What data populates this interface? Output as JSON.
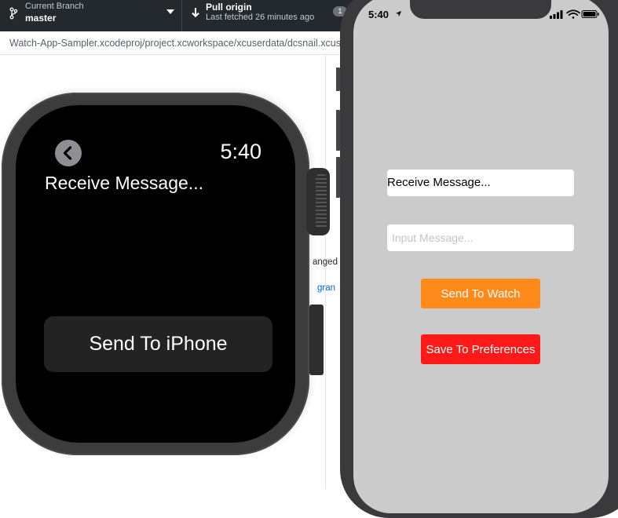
{
  "github_desktop": {
    "current_branch_caption": "Current Branch",
    "current_branch_name": "master",
    "pull_title": "Pull origin",
    "pull_subtitle": "Last fetched 26 minutes ago",
    "badge_count": "1",
    "file_path": "Watch-App-Sampler.xcodeproj/project.xcworkspace/xcuserdata/dcsnail.xcuserdatad/UserInterfaceState.xcuserstate",
    "fragment_changed": "anged",
    "fragment_link": "gran",
    "colors": {
      "toolbar": "#24292e",
      "link": "#0366d6"
    },
    "icons": {
      "branch": "git-branch-icon",
      "pull": "arrow-down-icon",
      "dropdown": "chevron-down-icon"
    }
  },
  "watch": {
    "time": "5:40",
    "message": "Receive Message...",
    "send_button": "Send To iPhone",
    "icons": {
      "back": "chevron-left-icon"
    },
    "colors": {
      "screen": "#000000",
      "button": "#232323",
      "case": "#3c3c3c"
    }
  },
  "iphone": {
    "status_time": "5:40",
    "received_message": "Receive Message...",
    "input_value": "",
    "input_placeholder": "Input Message...",
    "send_button": "Send To Watch",
    "save_button": "Save To Preferences",
    "icons": {
      "location": "location-arrow-icon",
      "signal": "signal-icon",
      "wifi": "wifi-icon",
      "battery": "battery-icon"
    },
    "colors": {
      "background": "#cbcbcb",
      "send": "#ff8a1c",
      "save": "#ff1a1a"
    }
  }
}
